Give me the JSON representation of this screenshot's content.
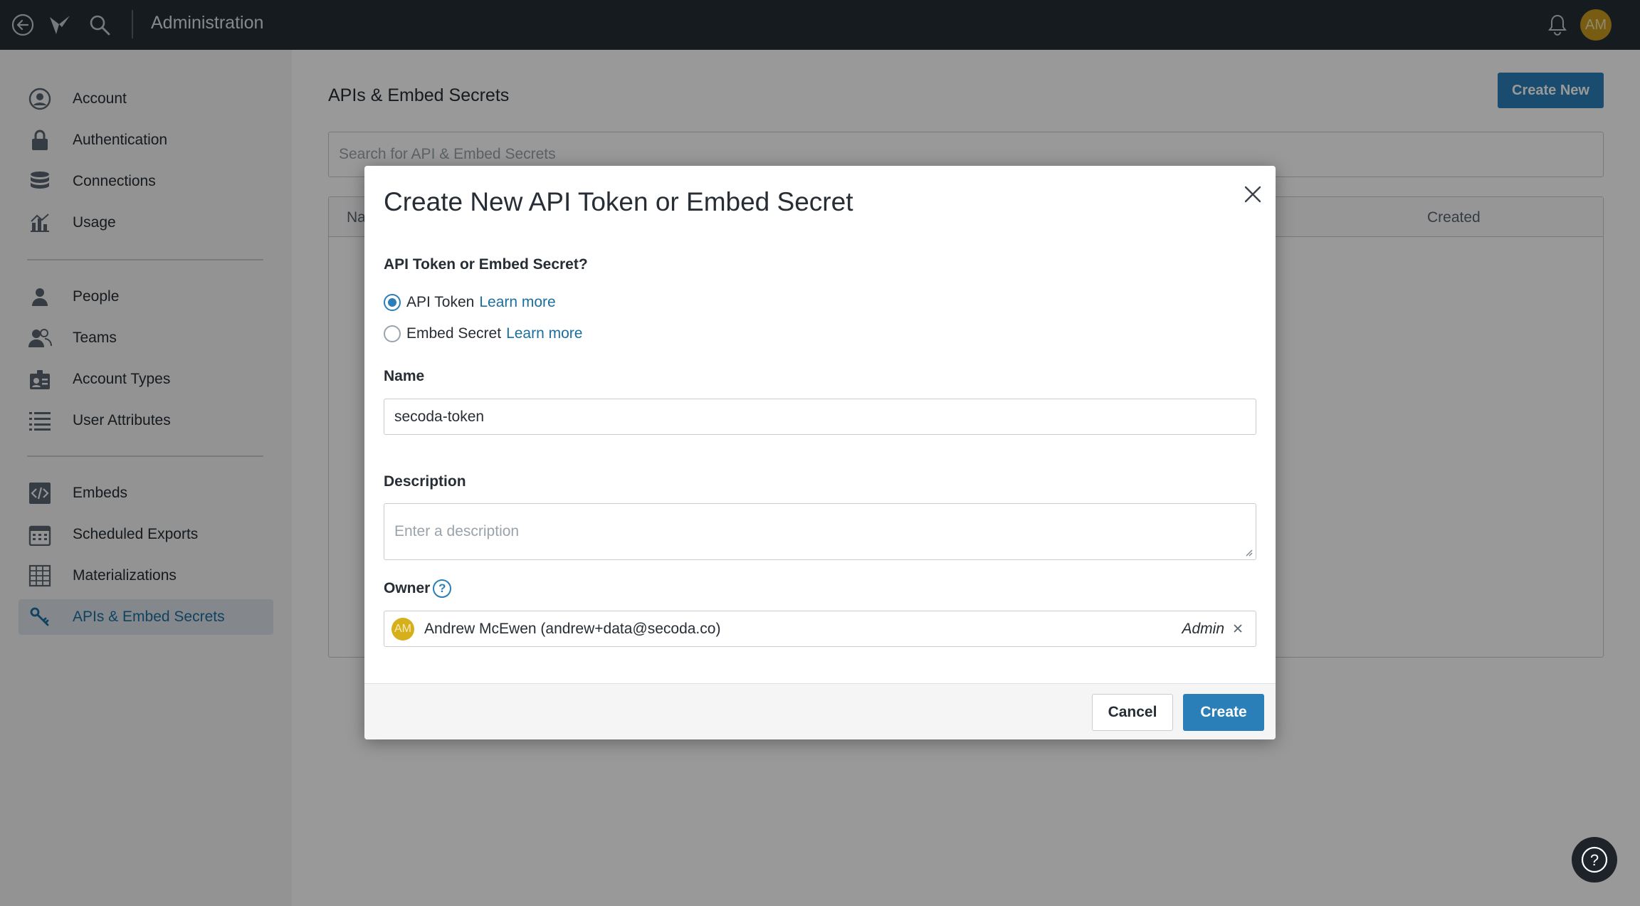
{
  "topbar": {
    "title": "Administration",
    "avatar_initials": "AM",
    "icons": [
      "back-icon",
      "logo-icon",
      "search-icon",
      "bell-icon"
    ]
  },
  "sidebar": {
    "items": [
      {
        "label": "Account",
        "icon": "user-circle-icon"
      },
      {
        "label": "Authentication",
        "icon": "lock-icon"
      },
      {
        "label": "Connections",
        "icon": "database-icon"
      },
      {
        "label": "Usage",
        "icon": "chart-icon"
      },
      {
        "label": "People",
        "icon": "person-icon"
      },
      {
        "label": "Teams",
        "icon": "people-icon"
      },
      {
        "label": "Account Types",
        "icon": "id-badge-icon"
      },
      {
        "label": "User Attributes",
        "icon": "list-icon"
      },
      {
        "label": "Embeds",
        "icon": "code-icon"
      },
      {
        "label": "Scheduled Exports",
        "icon": "calendar-icon"
      },
      {
        "label": "Materializations",
        "icon": "grid-icon"
      },
      {
        "label": "APIs & Embed Secrets",
        "icon": "key-icon",
        "active": true
      }
    ]
  },
  "main": {
    "title": "APIs & Embed Secrets",
    "create_new_label": "Create New",
    "search_placeholder": "Search for API & Embed Secrets",
    "table_headers": {
      "name": "Na",
      "created": "Created"
    }
  },
  "modal": {
    "title": "Create New API Token or Embed Secret",
    "type_label": "API Token or Embed Secret?",
    "options": [
      {
        "label": "API Token",
        "link": "Learn more",
        "checked": true
      },
      {
        "label": "Embed Secret",
        "link": "Learn more",
        "checked": false
      }
    ],
    "name_label": "Name",
    "name_value": "secoda-token",
    "description_label": "Description",
    "description_placeholder": "Enter a description",
    "owner_label": "Owner",
    "owner_help": "?",
    "owner_initials": "AM",
    "owner_name": "Andrew McEwen (andrew+data@secoda.co)",
    "owner_role": "Admin",
    "cancel_label": "Cancel",
    "create_label": "Create"
  },
  "help_fab": "?",
  "colors": {
    "accent": "#2b7fb8",
    "topbar": "#262d34",
    "avatar": "#c79a1f"
  }
}
